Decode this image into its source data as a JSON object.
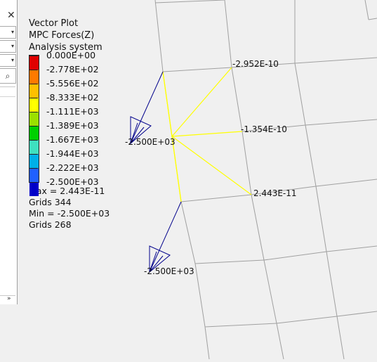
{
  "panel": {
    "close_glyph": "✕",
    "dropdowns": [
      {
        "icon": "chevron-down-icon",
        "glyph": "▾"
      },
      {
        "icon": "chevron-down-icon",
        "glyph": "▾"
      },
      {
        "icon": "chevron-down-icon",
        "glyph": "▾"
      }
    ],
    "search_glyph": "⌕",
    "expand_glyph": "»"
  },
  "legend": {
    "title": "Vector Plot",
    "subtitle": "MPC Forces(Z)",
    "system": "Analysis system",
    "labels": [
      "0.000E+00",
      "-2.778E+02",
      "-5.556E+02",
      "-8.333E+02",
      "-1.111E+03",
      "-1.389E+03",
      "-1.667E+03",
      "-1.944E+03",
      "-2.222E+03",
      "-2.500E+03"
    ],
    "colors": [
      "#e00000",
      "#ff7a00",
      "#ffc000",
      "#ffff00",
      "#9be000",
      "#00d000",
      "#3fe0c0",
      "#00b0e8",
      "#2060ff",
      "#0000c8"
    ],
    "max_text": "Max =  2.443E-11",
    "max_grid": "Grids 344",
    "min_text": "Min = -2.500E+03",
    "min_grid": "Grids 268"
  },
  "plot": {
    "element_color": "#ffff00",
    "vector_color": "#00008b",
    "mesh_color": "#a0a0a0",
    "labels": {
      "top_right": "-2.952E-10",
      "mid_right": "-1.354E-10",
      "lower_right": "2.443E-11",
      "upper_arrow": "-2.500E+03",
      "lower_arrow": "-2.500E+03"
    }
  }
}
